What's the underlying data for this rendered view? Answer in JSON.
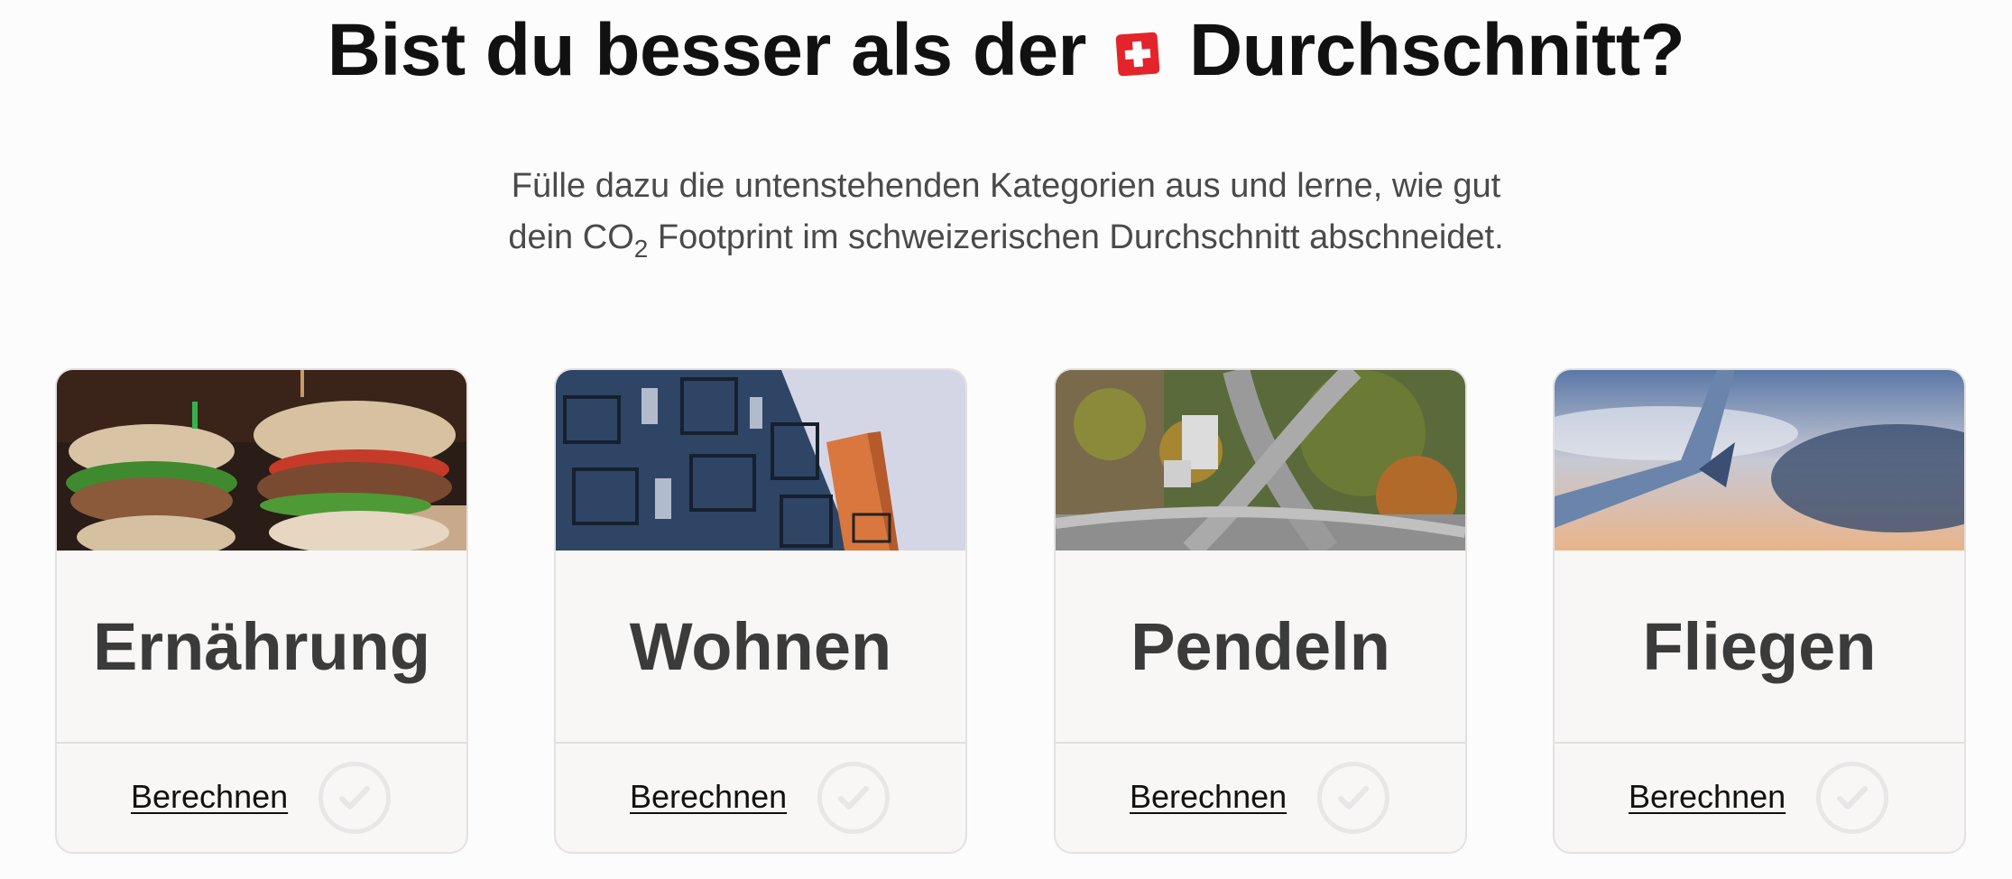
{
  "header": {
    "title_before_flag": "Bist du besser als der",
    "title_after_flag": "Durchschnitt?",
    "flag_icon": "swiss-flag-icon"
  },
  "intro": {
    "line1": "Fülle dazu die untenstehenden Kategorien aus und lerne, wie gut",
    "line2_before_sub": "dein CO",
    "line2_sub": "2",
    "line2_after_sub": " Footprint im schweizerischen Durchschnitt abschneidet."
  },
  "colors": {
    "flag_red": "#e3242b",
    "title_text": "#111111",
    "card_bg": "#f8f7f6",
    "card_border": "#e3e1e1",
    "check_gray": "#e8e6e6"
  },
  "cards": [
    {
      "title": "Ernährung",
      "action_label": "Berechnen",
      "image": "burgers-photo",
      "status_icon": "check-circle-icon"
    },
    {
      "title": "Wohnen",
      "action_label": "Berechnen",
      "image": "apartment-building-photo",
      "status_icon": "check-circle-icon"
    },
    {
      "title": "Pendeln",
      "action_label": "Berechnen",
      "image": "highway-aerial-photo",
      "status_icon": "check-circle-icon"
    },
    {
      "title": "Fliegen",
      "action_label": "Berechnen",
      "image": "airplane-wing-photo",
      "status_icon": "check-circle-icon"
    }
  ]
}
